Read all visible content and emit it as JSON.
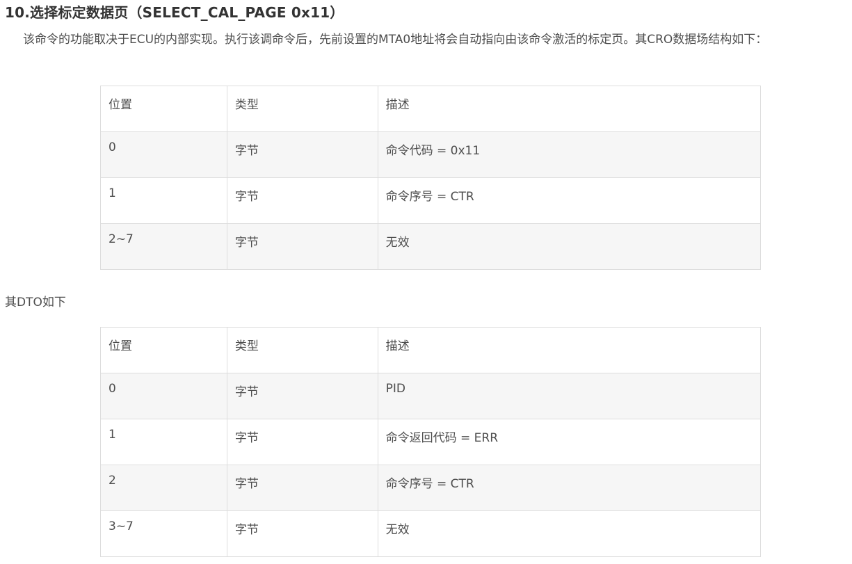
{
  "heading": "10.选择标定数据页（SELECT_CAL_PAGE 0x11）",
  "paragraph": "该命令的功能取决于ECU的内部实现。执行该调命令后，先前设置的MTA0地址将会自动指向由该命令激活的标定页。其CRO数据场结构如下：",
  "cro_table": {
    "headers": [
      "位置",
      "类型",
      "描述"
    ],
    "rows": [
      [
        "0",
        "字节",
        "命令代码 = 0x11"
      ],
      [
        "1",
        "字节",
        "命令序号 = CTR"
      ],
      [
        "2~7",
        "字节",
        "无效"
      ]
    ]
  },
  "dto_intro": "其DTO如下",
  "dto_table": {
    "headers": [
      "位置",
      "类型",
      "描述"
    ],
    "rows": [
      [
        "0",
        "字节",
        "PID"
      ],
      [
        "1",
        "字节",
        "命令返回代码 = ERR"
      ],
      [
        "2",
        "字节",
        "命令序号 = CTR"
      ],
      [
        "3~7",
        "字节",
        "无效"
      ]
    ]
  }
}
